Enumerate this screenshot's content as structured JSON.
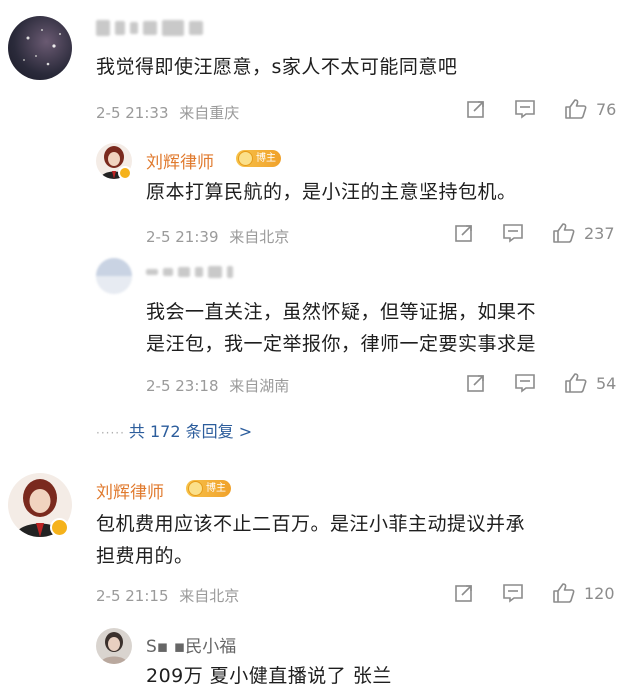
{
  "comments": [
    {
      "text": "我觉得即使汪愿意，s家人不太可能同意吧",
      "time": "2-5 21:33",
      "location": "来自重庆",
      "likes": "76"
    },
    {
      "name": "刘辉律师",
      "badge": "博主",
      "text": "原本打算民航的，是小汪的主意坚持包机。",
      "time": "2-5 21:39",
      "location": "来自北京",
      "likes": "237"
    },
    {
      "text_line1": "我会一直关注，虽然怀疑，但等证据，如果不",
      "text_line2": "是汪包，我一定举报你，律师一定要实事求是",
      "time": "2-5 23:18",
      "location": "来自湖南",
      "likes": "54"
    },
    {
      "name": "刘辉律师",
      "badge": "博主",
      "text_line1": "包机费用应该不止二百万。是汪小菲主动提议并承",
      "text_line2": "担费用的。",
      "time": "2-5 21:15",
      "location": "来自北京",
      "likes": "120"
    },
    {
      "name_partial": "S▪ ▪民小福",
      "text": "209万 夏小健直播说了 张兰"
    }
  ],
  "replies_link": "共 172 条回复 >",
  "colors": {
    "lawyer_name": "#e07a2e",
    "link": "#2c5d9c",
    "meta": "#9a9a9a"
  },
  "icons": [
    "share-icon",
    "comment-icon",
    "thumbs-up-icon"
  ]
}
